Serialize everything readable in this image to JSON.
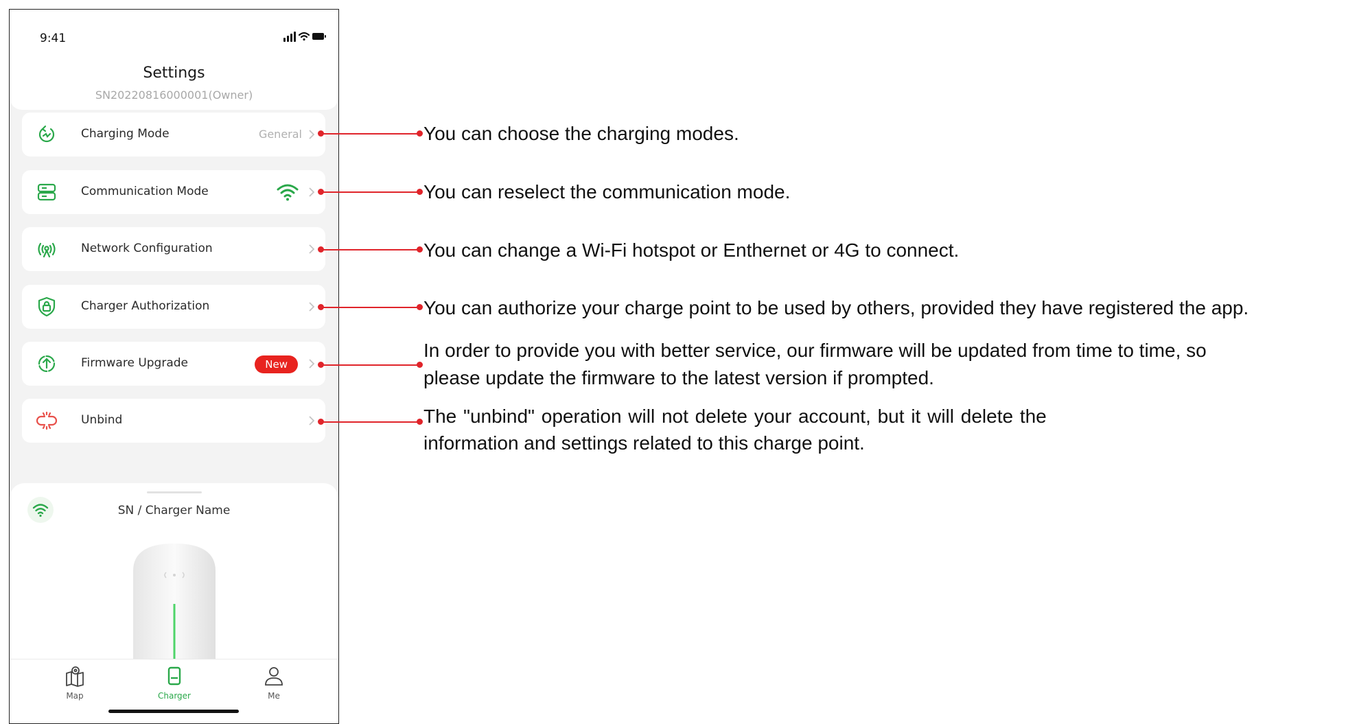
{
  "status_bar": {
    "time": "9:41"
  },
  "header": {
    "title": "Settings",
    "subtitle": "SN20220816000001(Owner)"
  },
  "menu": [
    {
      "label": "Charging Mode",
      "value": "General",
      "icon": "charging-mode-icon"
    },
    {
      "label": "Communication Mode",
      "value": "",
      "icon": "communication-mode-icon"
    },
    {
      "label": "Network Configuration",
      "value": "",
      "icon": "network-config-icon"
    },
    {
      "label": "Charger Authorization",
      "value": "",
      "icon": "shield-lock-icon"
    },
    {
      "label": "Firmware Upgrade",
      "value": "",
      "badge": "New",
      "icon": "firmware-upgrade-icon"
    },
    {
      "label": "Unbind",
      "value": "",
      "icon": "unlink-icon"
    }
  ],
  "sheet": {
    "title": "SN / Charger Name"
  },
  "tabs": [
    {
      "label": "Map",
      "icon": "map-pin-icon"
    },
    {
      "label": "Charger",
      "icon": "charger-icon"
    },
    {
      "label": "Me",
      "icon": "user-icon"
    }
  ],
  "annotations": [
    "You can choose the charging modes.",
    "You can reselect the communication mode.",
    "You can change a Wi-Fi hotspot or Enthernet  or 4G to connect.",
    "You can authorize your charge point to be used by others, provided they have registered the app.",
    "In order to provide you with better service, our firmware will be updated from time to time, so",
    "please update the firmware to the latest version if prompted.",
    "The \"unbind\" operation will not delete your account, but it will delete the",
    "information and settings related to this charge point."
  ],
  "colors": {
    "accent": "#2aa84a",
    "badge": "#e8231f",
    "callout": "#e0242a"
  }
}
